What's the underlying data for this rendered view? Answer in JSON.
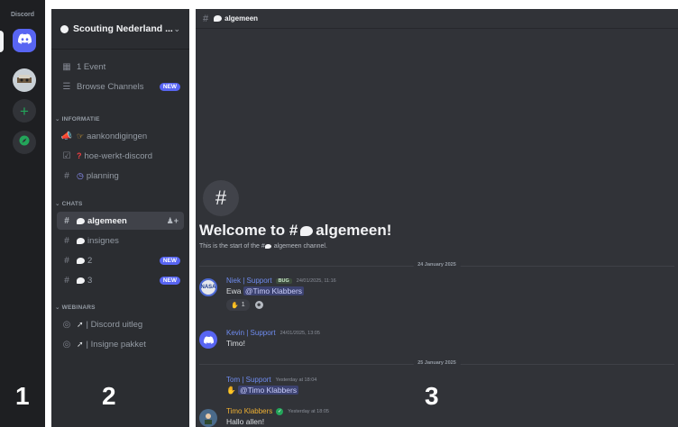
{
  "rail": {
    "title": "Discord",
    "section_number": "1"
  },
  "sidebar": {
    "section_number": "2",
    "server_name": "Scouting Nederland ...",
    "events_label": "1 Event",
    "browse_label": "Browse Channels",
    "browse_badge": "NEW",
    "categories": [
      {
        "label": "INFORMATIE",
        "channels": [
          {
            "name": "aankondigingen"
          },
          {
            "name": "hoe-werkt-discord"
          },
          {
            "name": "planning"
          }
        ]
      },
      {
        "label": "CHATS",
        "channels": [
          {
            "name": "algemeen"
          },
          {
            "name": "insignes"
          },
          {
            "name": "2",
            "badge": "NEW"
          },
          {
            "name": "3",
            "badge": "NEW"
          }
        ]
      },
      {
        "label": "WEBINARS",
        "channels": [
          {
            "name": "| Discord uitleg"
          },
          {
            "name": "| Insigne pakket"
          }
        ]
      }
    ]
  },
  "chat": {
    "section_number": "3",
    "channel_name": "algemeen",
    "welcome_title": "Welcome to #",
    "welcome_title_channel": "algemeen!",
    "welcome_sub_pre": "This is the start of the #",
    "welcome_sub_post": "algemeen channel.",
    "date_separators": [
      "24 January 2025",
      "25 January 2025"
    ],
    "messages": [
      {
        "author": "Niek | Support",
        "tag": "BUG",
        "timestamp": "24/01/2025, 11:16",
        "text_pre": "Ewa",
        "mention": "@Timo Klabbers",
        "avatar_text": "NASA",
        "reaction_count": "1"
      },
      {
        "author": "Kevin | Support",
        "timestamp": "24/01/2025, 13:05",
        "text": "Timo!"
      },
      {
        "author": "Tom | Support",
        "timestamp": "Yesterday at 18:04",
        "mention": "@Timo Klabbers"
      },
      {
        "author": "Timo Klabbers",
        "timestamp": "Yesterday at 18:05",
        "text": "Hallo allen!"
      }
    ]
  },
  "colors": {
    "rail_bg": "#1e1f22",
    "sidebar_bg": "#2b2d31",
    "chat_bg": "#313338",
    "accent": "#5865f2",
    "green": "#23a55a",
    "link_blue": "#6f8cf0",
    "gold": "#f0b132"
  },
  "icons": [
    "discord-logo-icon",
    "add-server-icon",
    "compass-icon",
    "calendar-icon",
    "browse-channels-icon",
    "megaphone-icon",
    "rules-icon",
    "hash-icon",
    "speech-bubble-icon",
    "stage-icon",
    "add-member-icon",
    "chevron-down-icon"
  ]
}
